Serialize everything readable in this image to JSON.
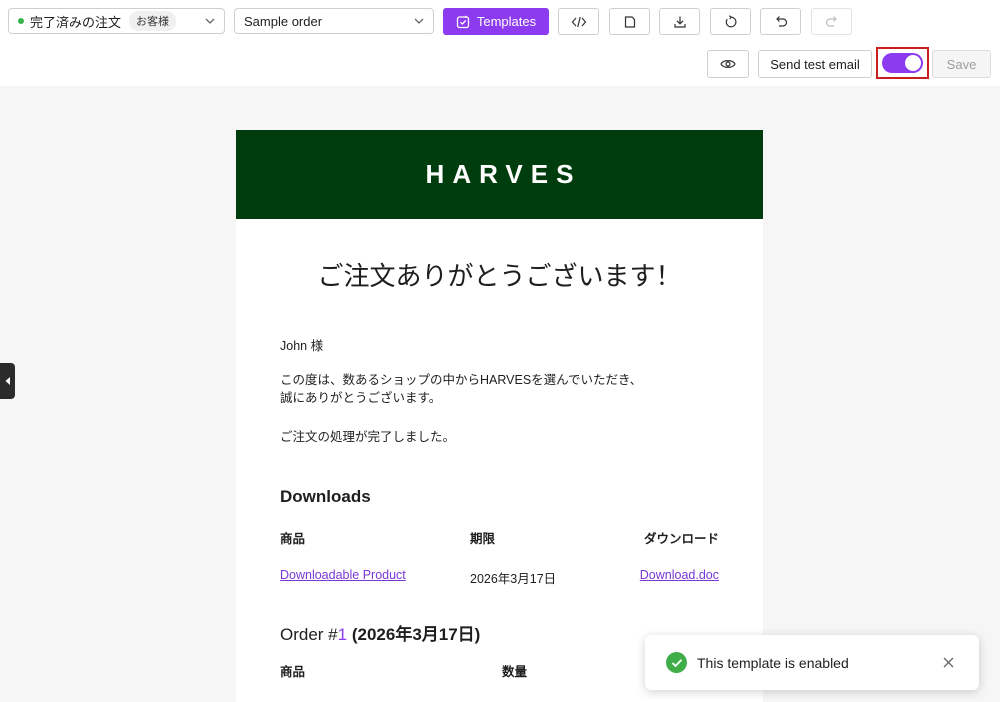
{
  "toolbar": {
    "status_select": {
      "label": "完了済みの注文",
      "badge": "お客様",
      "status_color": "#36b34a"
    },
    "order_select": {
      "label": "Sample order"
    },
    "templates_label": "Templates",
    "icons": [
      "code-icon",
      "copy-icon",
      "download-icon",
      "reset-icon",
      "undo-icon",
      "redo-icon"
    ],
    "preview_icon": "eye-icon",
    "send_test_email_label": "Send test email",
    "enable_toggle": {
      "on": true
    },
    "save_label": "Save",
    "accent_color": "#8c3bf0"
  },
  "email": {
    "brand": "HARVES",
    "header_color": "#003d0e",
    "title": "ご注文ありがとうございます！",
    "greeting": "John 様",
    "body_line1": "この度は、数あるショップの中からHARVESを選んでいただき、",
    "body_line2": "誠にありがとうございます。",
    "completed_line": "ご注文の処理が完了しました。",
    "downloads": {
      "heading": "Downloads",
      "columns": [
        "商品",
        "期限",
        "ダウンロード"
      ],
      "rows": [
        {
          "product": "Downloadable Product",
          "expires": "2026年3月17日",
          "file": "Download.doc"
        }
      ]
    },
    "order": {
      "prefix": "Order #",
      "number": "1",
      "date": "(2026年3月17日)",
      "columns": [
        "商品",
        "数量"
      ]
    }
  },
  "toast": {
    "message": "This template is enabled",
    "check_icon": "check-circle-icon",
    "close_icon": "close-icon"
  }
}
